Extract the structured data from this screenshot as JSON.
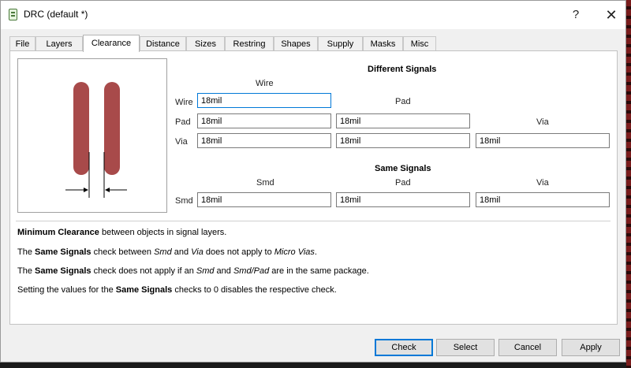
{
  "window": {
    "title": "DRC (default *)",
    "help": "?",
    "close": "✕"
  },
  "tabs": [
    {
      "label": "File",
      "active": false
    },
    {
      "label": "Layers",
      "active": false
    },
    {
      "label": "Clearance",
      "active": true
    },
    {
      "label": "Distance",
      "active": false
    },
    {
      "label": "Sizes",
      "active": false
    },
    {
      "label": "Restring",
      "active": false
    },
    {
      "label": "Shapes",
      "active": false
    },
    {
      "label": "Supply",
      "active": false
    },
    {
      "label": "Masks",
      "active": false
    },
    {
      "label": "Misc",
      "active": false
    }
  ],
  "colors": {
    "pad": "#a84a4a",
    "focus": "#0078d7"
  },
  "different_signals": {
    "title": "Different Signals",
    "col_wire": "Wire",
    "col_pad": "Pad",
    "col_via": "Via",
    "row_wire": "Wire",
    "row_pad": "Pad",
    "row_via": "Via",
    "wire_wire": "18mil",
    "pad_wire": "18mil",
    "pad_pad": "18mil",
    "via_wire": "18mil",
    "via_pad": "18mil",
    "via_via": "18mil"
  },
  "same_signals": {
    "title": "Same Signals",
    "col_smd": "Smd",
    "col_pad": "Pad",
    "col_via": "Via",
    "row_smd": "Smd",
    "smd_smd": "18mil",
    "smd_pad": "18mil",
    "smd_via": "18mil"
  },
  "description": {
    "line1": {
      "b1": "Minimum Clearance",
      "t1": " between objects in signal layers."
    },
    "line2": {
      "t1": "The ",
      "b1": "Same Signals",
      "t2": " check between ",
      "i1": "Smd",
      "t3": " and ",
      "i2": "Via",
      "t4": " does not apply to ",
      "i3": "Micro Vias",
      "t5": "."
    },
    "line3": {
      "t1": "The ",
      "b1": "Same Signals",
      "t2": " check does not apply if an ",
      "i1": "Smd",
      "t3": " and ",
      "i2": "Smd/Pad",
      "t4": " are in the same package."
    },
    "line4": {
      "t1": "Setting the values for the ",
      "b1": "Same Signals",
      "t2": " checks to 0 disables the respective check."
    }
  },
  "buttons": {
    "check": "Check",
    "select": "Select",
    "cancel": "Cancel",
    "apply": "Apply"
  }
}
